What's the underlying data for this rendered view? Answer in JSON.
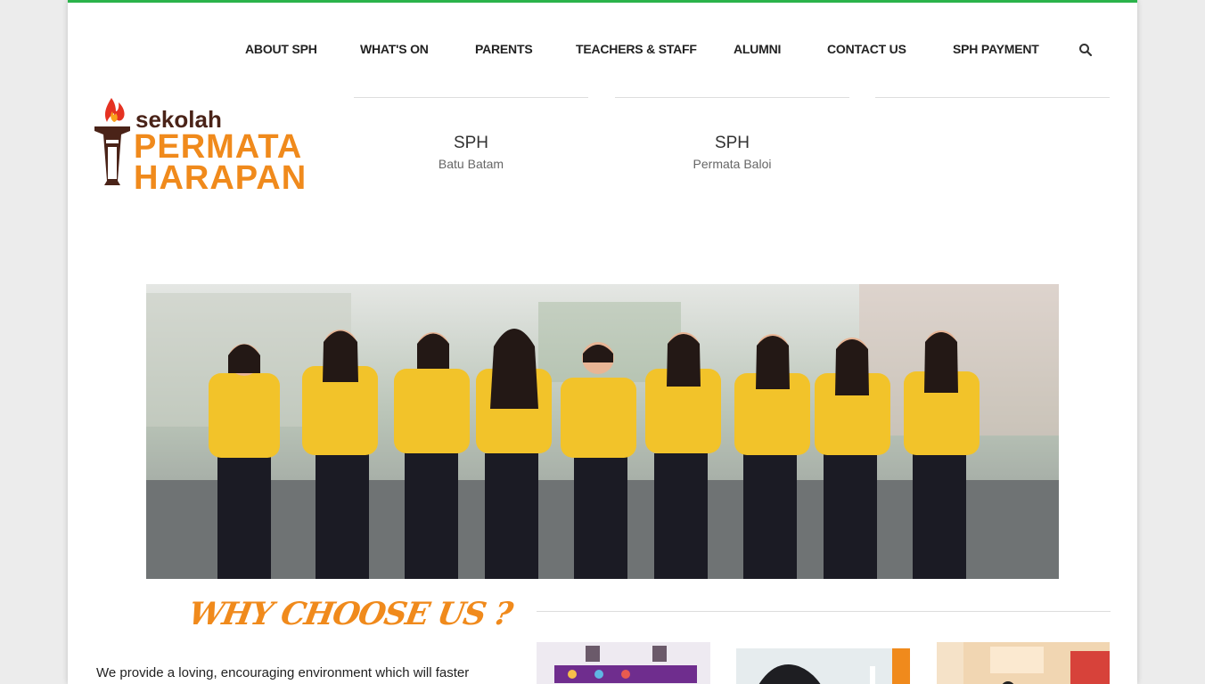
{
  "nav": {
    "items": [
      "ABOUT SPH",
      "WHAT'S ON",
      "PARENTS",
      "TEACHERS & STAFF",
      "ALUMNI",
      "CONTACT US",
      "SPH PAYMENT"
    ],
    "search_icon": "search-icon"
  },
  "logo": {
    "line1": "sekolah",
    "line2": "PERMATA",
    "line3": "HARAPAN",
    "icon": "torch-icon"
  },
  "campuses": [
    {
      "title": "SPH",
      "subtitle": "Batu Batam"
    },
    {
      "title": "SPH",
      "subtitle": "Permata Baloi"
    }
  ],
  "hero": {
    "image": "students-in-yellow-shirts-thumbs-up"
  },
  "why": {
    "heading": "WHY CHOOSE US ?",
    "text": "We provide a loving, encouraging environment which will faster"
  },
  "colors": {
    "accent": "#f08a1c",
    "top_bar": "#2bb34a",
    "logo_dark": "#4a2318"
  }
}
